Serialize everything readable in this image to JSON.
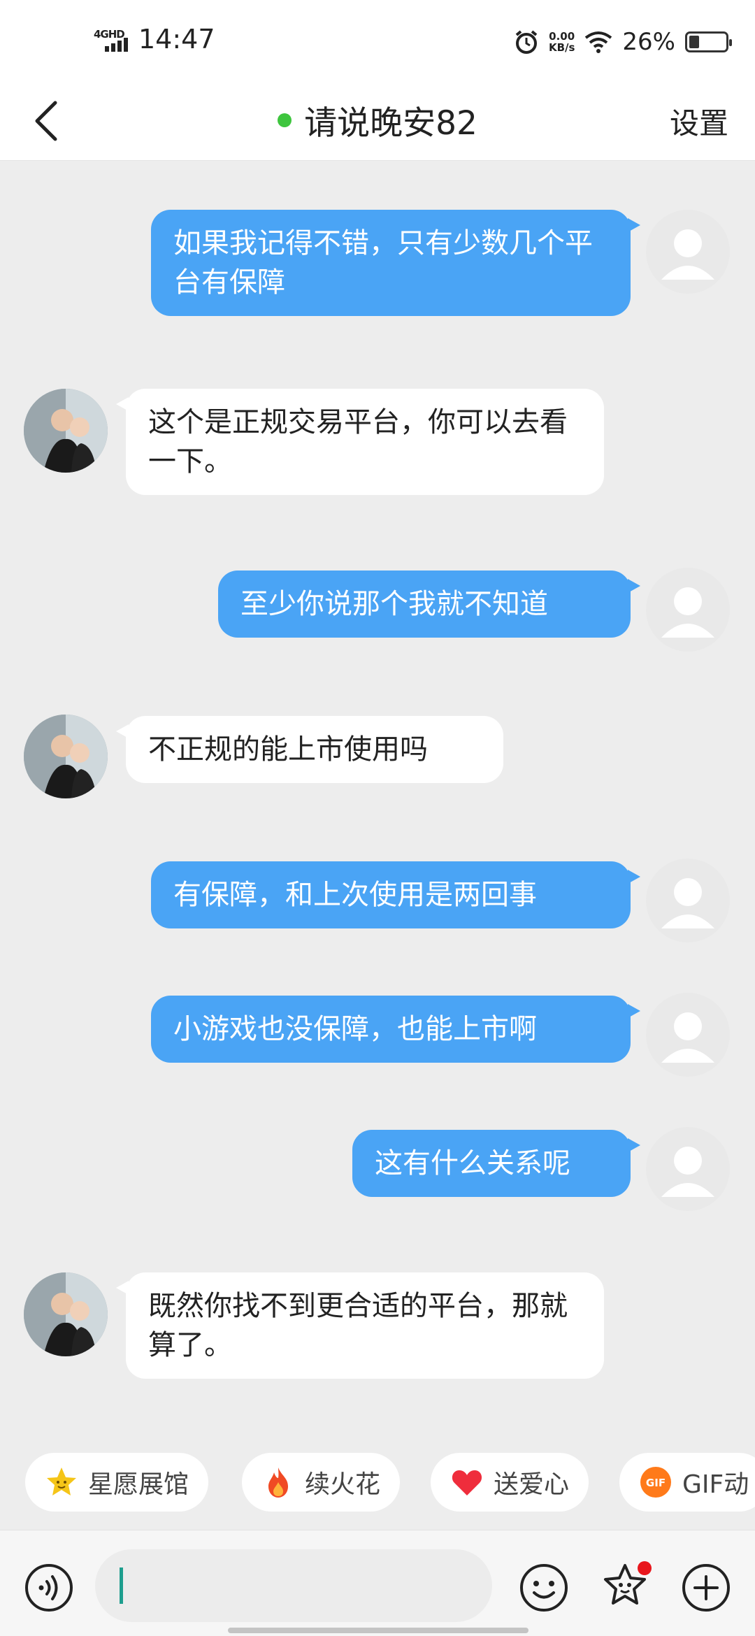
{
  "status_bar": {
    "network": "4GHD",
    "time": "14:47",
    "speed_value": "0.00",
    "speed_unit": "KB/s",
    "battery": "26%"
  },
  "header": {
    "title": "请说晚安82",
    "settings_label": "设置"
  },
  "messages": [
    {
      "from": "me",
      "text": "如果我记得不错，只有少数几个平台有保障"
    },
    {
      "from": "them",
      "text": "这个是正规交易平台，你可以去看一下。"
    },
    {
      "from": "me",
      "text": "至少你说那个我就不知道"
    },
    {
      "from": "them",
      "text": "不正规的能上市使用吗"
    },
    {
      "from": "me",
      "text": "有保障，和上次使用是两回事"
    },
    {
      "from": "me",
      "text": "小游戏也没保障，也能上市啊"
    },
    {
      "from": "me",
      "text": "这有什么关系呢"
    },
    {
      "from": "them",
      "text": "既然你找不到更合适的平台，那就算了。"
    }
  ],
  "chips": [
    {
      "label": "星愿展馆",
      "icon": "star-face-icon"
    },
    {
      "label": "续火花",
      "icon": "fire-icon"
    },
    {
      "label": "送爱心",
      "icon": "heart-icon"
    },
    {
      "label": "GIF动",
      "icon": "gif-icon"
    }
  ],
  "input": {
    "placeholder": "",
    "value": ""
  },
  "colors": {
    "my_bubble": "#4aa4f5",
    "their_bubble": "#ffffff",
    "background": "#ededed",
    "online_dot": "#3ec53e",
    "notification_dot": "#e8161c"
  }
}
